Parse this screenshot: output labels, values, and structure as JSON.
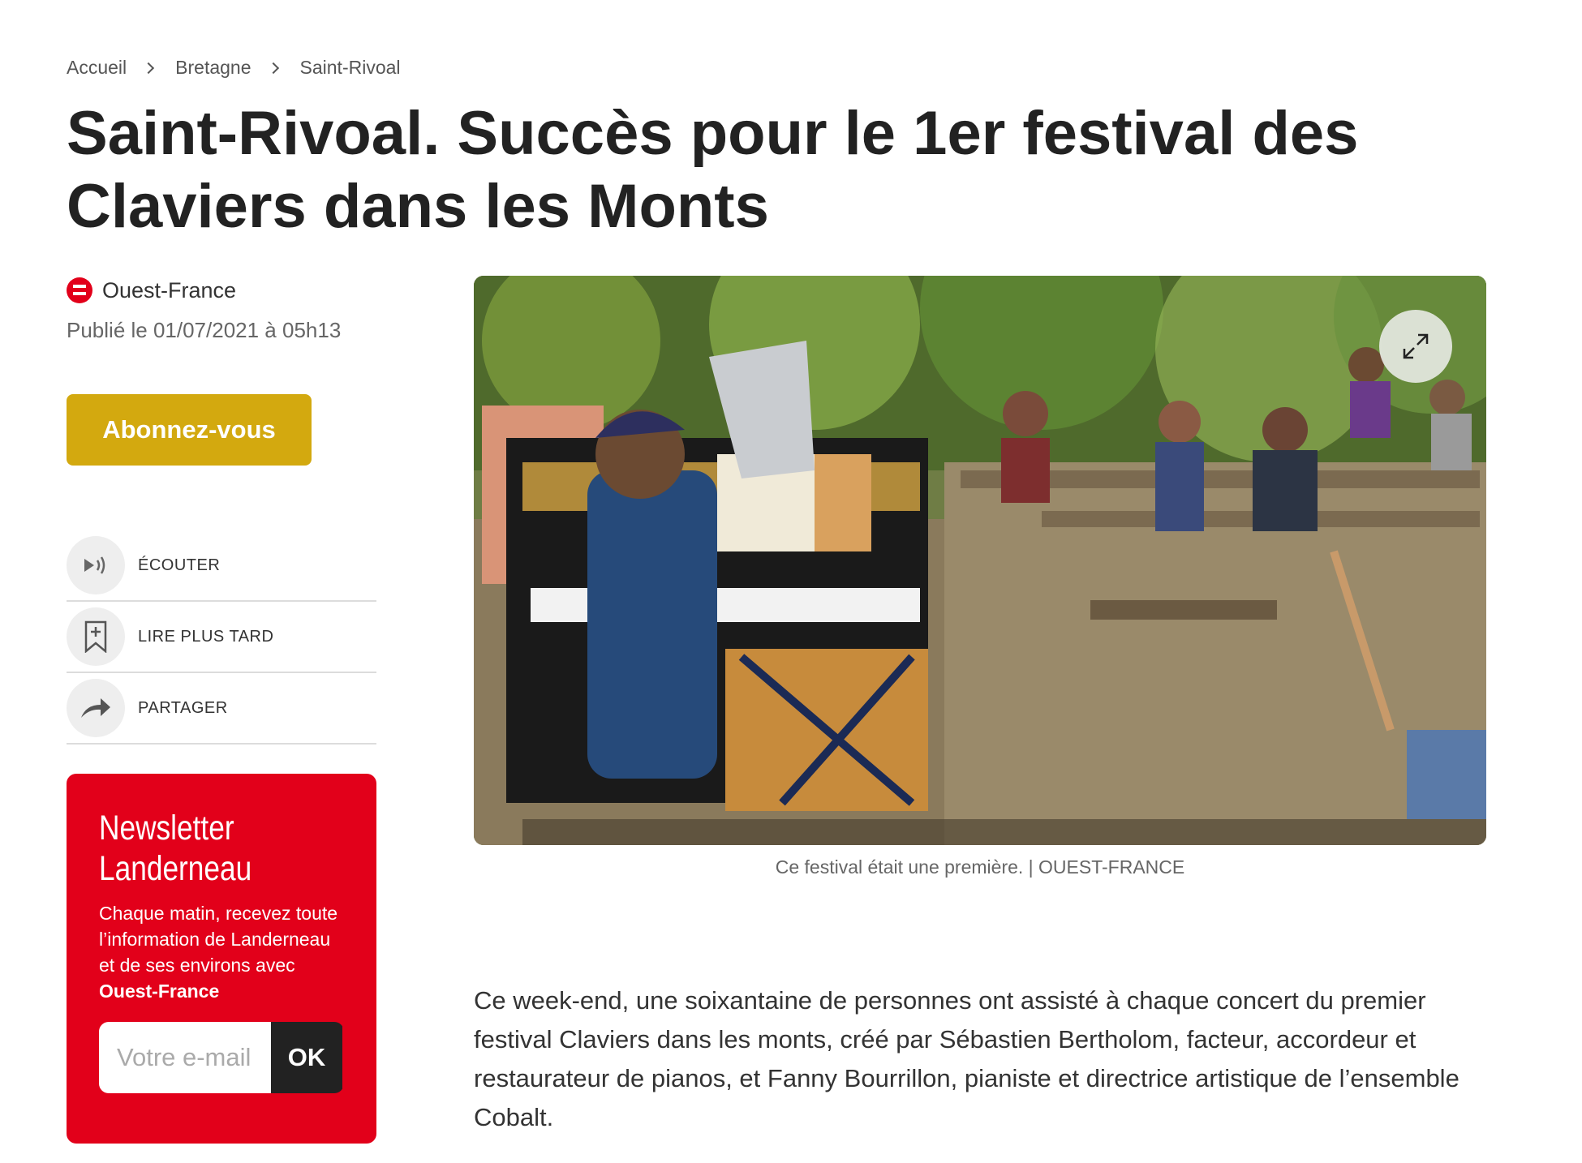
{
  "breadcrumb": [
    "Accueil",
    "Bretagne",
    "Saint-Rivoal"
  ],
  "article": {
    "title": "Saint-Rivoal. Succès pour le 1er festival des Claviers dans les Monts",
    "source": "Ouest-France",
    "published": "Publié le 01/07/2021 à 05h13",
    "body": "Ce week-end, une soixantaine de personnes ont assisté à chaque concert du premier festival Claviers dans les monts, créé par Sébastien Bertholom, facteur, accordeur et restaurateur de pianos, et Fanny Bourrillon, pianiste et directrice artistique de l’ensemble Cobalt."
  },
  "subscribe_label": "Abonnez-vous",
  "actions": [
    {
      "label": "ÉCOUTER",
      "icon": "speaker-icon"
    },
    {
      "label": "LIRE PLUS TARD",
      "icon": "bookmark-add-icon"
    },
    {
      "label": "PARTAGER",
      "icon": "share-arrow-icon"
    }
  ],
  "newsletter": {
    "title": "Newsletter Landerneau",
    "text": "Chaque matin, recevez toute l’information de Landerneau et de ses environs avec ",
    "text_bold": "Ouest-France",
    "placeholder": "Votre e-mail",
    "submit": "OK"
  },
  "photo": {
    "caption": "Ce festival était une première. | OUEST-FRANCE",
    "expand_icon": "expand-arrows-icon"
  },
  "colors": {
    "brand_red": "#e2001a",
    "subscribe_gold": "#d3a90f"
  }
}
